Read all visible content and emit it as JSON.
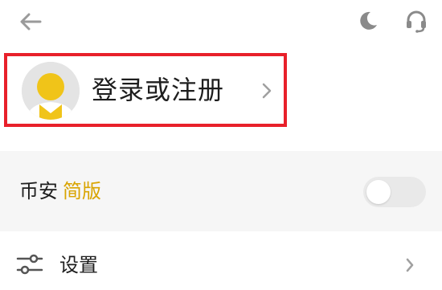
{
  "header": {
    "back_icon": "arrow-left-icon",
    "theme_icon": "moon-icon",
    "support_icon": "headset-icon"
  },
  "login": {
    "label": "登录或注册",
    "avatar_icon": "default-avatar-icon",
    "chevron_icon": "chevron-right-icon",
    "highlight_color": "#e8202a"
  },
  "simple_mode": {
    "label": "币安",
    "accent_label": "简版",
    "accent_color": "#d9a400",
    "toggle_on": false
  },
  "settings": {
    "label": "设置",
    "icon": "sliders-icon",
    "chevron_icon": "chevron-right-icon"
  }
}
